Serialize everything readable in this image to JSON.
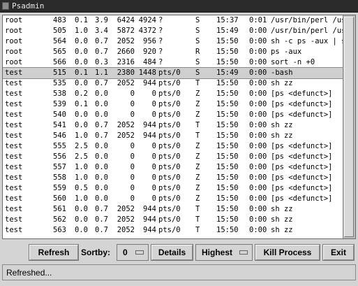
{
  "window": {
    "title": "Psadmin"
  },
  "process_list": {
    "selected_index": 5,
    "rows": [
      {
        "user": "root",
        "pid": "483",
        "cpu": "0.1",
        "mem": "3.9",
        "vsz": "6424",
        "rss": "4924",
        "tty": "?",
        "stat": "S",
        "start": "15:37",
        "time": "0:01",
        "cmd": "/usr/bin/perl /us"
      },
      {
        "user": "root",
        "pid": "505",
        "cpu": "1.0",
        "mem": "3.4",
        "vsz": "5872",
        "rss": "4372",
        "tty": "?",
        "stat": "S",
        "start": "15:49",
        "time": "0:00",
        "cmd": "/usr/bin/perl /us"
      },
      {
        "user": "root",
        "pid": "564",
        "cpu": "0.0",
        "mem": "0.7",
        "vsz": "2052",
        "rss": "956",
        "tty": "?",
        "stat": "S",
        "start": "15:50",
        "time": "0:00",
        "cmd": "sh -c ps -aux | s"
      },
      {
        "user": "root",
        "pid": "565",
        "cpu": "0.0",
        "mem": "0.7",
        "vsz": "2660",
        "rss": "920",
        "tty": "?",
        "stat": "R",
        "start": "15:50",
        "time": "0:00",
        "cmd": "ps -aux"
      },
      {
        "user": "root",
        "pid": "566",
        "cpu": "0.0",
        "mem": "0.3",
        "vsz": "2316",
        "rss": "484",
        "tty": "?",
        "stat": "S",
        "start": "15:50",
        "time": "0:00",
        "cmd": "sort -n +0"
      },
      {
        "user": "test",
        "pid": "515",
        "cpu": "0.1",
        "mem": "1.1",
        "vsz": "2380",
        "rss": "1448",
        "tty": "pts/0",
        "stat": "S",
        "start": "15:49",
        "time": "0:00",
        "cmd": "-bash"
      },
      {
        "user": "test",
        "pid": "535",
        "cpu": "0.0",
        "mem": "0.7",
        "vsz": "2052",
        "rss": "944",
        "tty": "pts/0",
        "stat": "T",
        "start": "15:50",
        "time": "0:00",
        "cmd": "sh zz"
      },
      {
        "user": "test",
        "pid": "538",
        "cpu": "0.2",
        "mem": "0.0",
        "vsz": "0",
        "rss": "0",
        "tty": "pts/0",
        "stat": "Z",
        "start": "15:50",
        "time": "0:00",
        "cmd": "[ps <defunct>]"
      },
      {
        "user": "test",
        "pid": "539",
        "cpu": "0.1",
        "mem": "0.0",
        "vsz": "0",
        "rss": "0",
        "tty": "pts/0",
        "stat": "Z",
        "start": "15:50",
        "time": "0:00",
        "cmd": "[ps <defunct>]"
      },
      {
        "user": "test",
        "pid": "540",
        "cpu": "0.0",
        "mem": "0.0",
        "vsz": "0",
        "rss": "0",
        "tty": "pts/0",
        "stat": "Z",
        "start": "15:50",
        "time": "0:00",
        "cmd": "[ps <defunct>]"
      },
      {
        "user": "test",
        "pid": "541",
        "cpu": "0.0",
        "mem": "0.7",
        "vsz": "2052",
        "rss": "944",
        "tty": "pts/0",
        "stat": "T",
        "start": "15:50",
        "time": "0:00",
        "cmd": "sh zz"
      },
      {
        "user": "test",
        "pid": "546",
        "cpu": "1.0",
        "mem": "0.7",
        "vsz": "2052",
        "rss": "944",
        "tty": "pts/0",
        "stat": "T",
        "start": "15:50",
        "time": "0:00",
        "cmd": "sh zz"
      },
      {
        "user": "test",
        "pid": "555",
        "cpu": "2.5",
        "mem": "0.0",
        "vsz": "0",
        "rss": "0",
        "tty": "pts/0",
        "stat": "Z",
        "start": "15:50",
        "time": "0:00",
        "cmd": "[ps <defunct>]"
      },
      {
        "user": "test",
        "pid": "556",
        "cpu": "2.5",
        "mem": "0.0",
        "vsz": "0",
        "rss": "0",
        "tty": "pts/0",
        "stat": "Z",
        "start": "15:50",
        "time": "0:00",
        "cmd": "[ps <defunct>]"
      },
      {
        "user": "test",
        "pid": "557",
        "cpu": "1.0",
        "mem": "0.0",
        "vsz": "0",
        "rss": "0",
        "tty": "pts/0",
        "stat": "Z",
        "start": "15:50",
        "time": "0:00",
        "cmd": "[ps <defunct>]"
      },
      {
        "user": "test",
        "pid": "558",
        "cpu": "1.0",
        "mem": "0.0",
        "vsz": "0",
        "rss": "0",
        "tty": "pts/0",
        "stat": "Z",
        "start": "15:50",
        "time": "0:00",
        "cmd": "[ps <defunct>]"
      },
      {
        "user": "test",
        "pid": "559",
        "cpu": "0.5",
        "mem": "0.0",
        "vsz": "0",
        "rss": "0",
        "tty": "pts/0",
        "stat": "Z",
        "start": "15:50",
        "time": "0:00",
        "cmd": "[ps <defunct>]"
      },
      {
        "user": "test",
        "pid": "560",
        "cpu": "1.0",
        "mem": "0.0",
        "vsz": "0",
        "rss": "0",
        "tty": "pts/0",
        "stat": "Z",
        "start": "15:50",
        "time": "0:00",
        "cmd": "[ps <defunct>]"
      },
      {
        "user": "test",
        "pid": "561",
        "cpu": "0.0",
        "mem": "0.7",
        "vsz": "2052",
        "rss": "944",
        "tty": "pts/0",
        "stat": "T",
        "start": "15:50",
        "time": "0:00",
        "cmd": "sh zz"
      },
      {
        "user": "test",
        "pid": "562",
        "cpu": "0.0",
        "mem": "0.7",
        "vsz": "2052",
        "rss": "944",
        "tty": "pts/0",
        "stat": "T",
        "start": "15:50",
        "time": "0:00",
        "cmd": "sh zz"
      },
      {
        "user": "test",
        "pid": "563",
        "cpu": "0.0",
        "mem": "0.7",
        "vsz": "2052",
        "rss": "944",
        "tty": "pts/0",
        "stat": "T",
        "start": "15:50",
        "time": "0:00",
        "cmd": "sh zz"
      }
    ]
  },
  "toolbar": {
    "refresh_label": "Refresh",
    "sortby_label": "Sortby:",
    "sortby_value": "0",
    "details_label": "Details",
    "priority_value": "Highest",
    "kill_label": "Kill Process",
    "exit_label": "Exit"
  },
  "status": {
    "text": "Refreshed..."
  }
}
